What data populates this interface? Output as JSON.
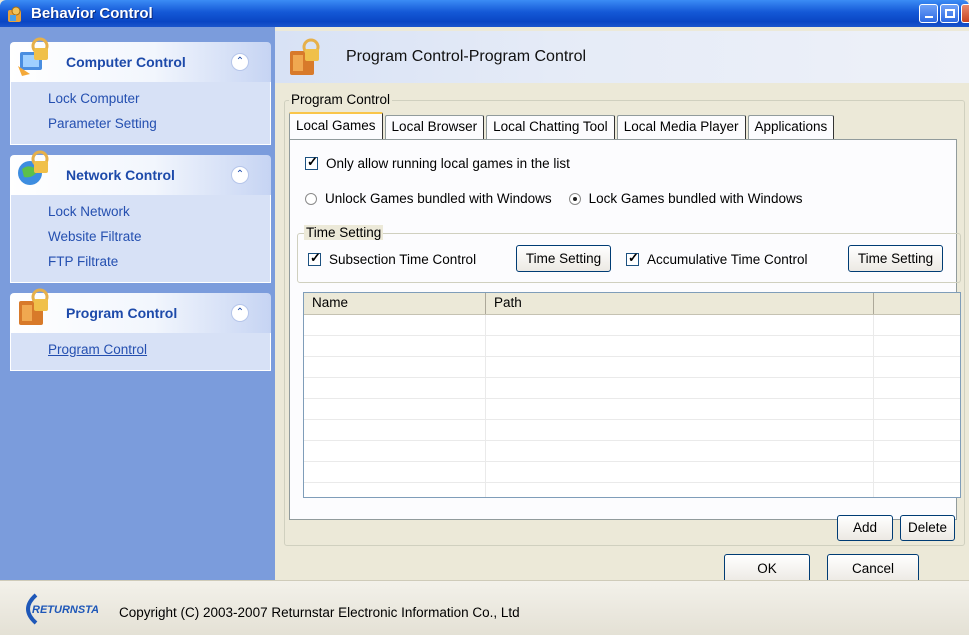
{
  "window": {
    "title": "Behavior Control"
  },
  "sidebar": {
    "groups": [
      {
        "title": "Computer Control",
        "items": [
          "Lock Computer",
          "Parameter Setting"
        ]
      },
      {
        "title": "Network Control",
        "items": [
          "Lock Network",
          "Website Filtrate",
          "FTP Filtrate"
        ]
      },
      {
        "title": "Program Control",
        "items": [
          "Program Control"
        ]
      }
    ]
  },
  "header": {
    "title": "Program Control-Program Control"
  },
  "program_control": {
    "legend": "Program Control",
    "tabs": [
      "Local Games",
      "Local Browser",
      "Local Chatting Tool",
      "Local Media Player",
      "Applications"
    ],
    "active_tab": "Local Games",
    "only_allow": {
      "label": "Only allow running local games in the list",
      "checked": true
    },
    "radio_unlock": {
      "label": "Unlock Games bundled with Windows",
      "selected": false
    },
    "radio_lock": {
      "label": "Lock Games bundled with Windows",
      "selected": true
    },
    "time_setting": {
      "legend": "Time Setting",
      "subsection": {
        "label": "Subsection Time Control",
        "checked": true
      },
      "accumulative": {
        "label": "Accumulative Time Control",
        "checked": true
      },
      "button_label": "Time Setting"
    },
    "table": {
      "columns": [
        "Name",
        "Path",
        ""
      ],
      "rows": []
    },
    "add_label": "Add",
    "delete_label": "Delete"
  },
  "dialog": {
    "ok_label": "OK",
    "cancel_label": "Cancel"
  },
  "footer": {
    "logo_text": "RETURNSTAR",
    "copyright": "Copyright (C) 2003-2007 Returnstar Electronic Information Co., Ltd"
  }
}
